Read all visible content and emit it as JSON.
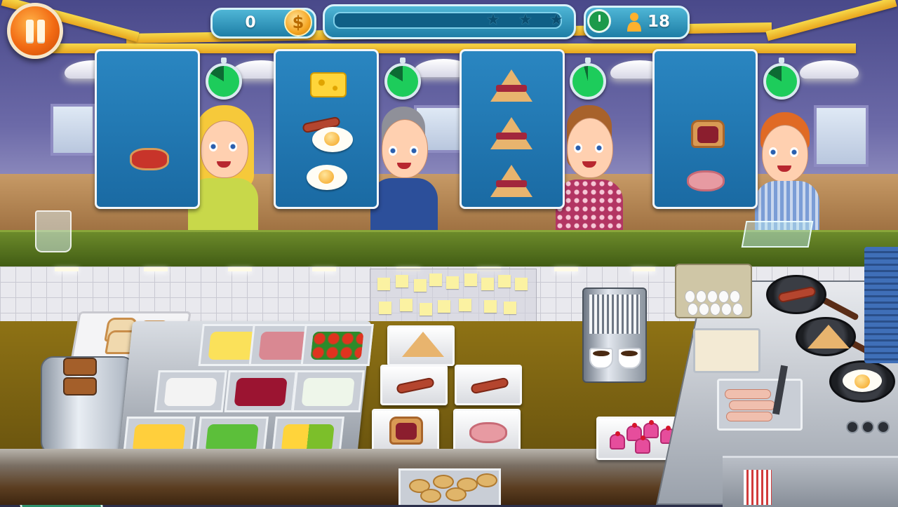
{
  "hud": {
    "score": "0",
    "coin_symbol": "$",
    "progress_fraction": 0,
    "stars": [
      "★",
      "★",
      "★"
    ],
    "customers_left": "18"
  },
  "orders": [
    {
      "items": [
        "tomato-toast"
      ],
      "timer_fraction": 0.85
    },
    {
      "items": [
        "cheese",
        "sausage-and-egg",
        "fried-egg"
      ],
      "timer_fraction": 0.85
    },
    {
      "items": [
        "jam-crepe",
        "jam-crepe",
        "jam-crepe"
      ],
      "timer_fraction": 0.95
    },
    {
      "items": [
        "jam-toast",
        "ham-toast"
      ],
      "timer_fraction": 0.85
    }
  ],
  "icons": {
    "pause": "pause-icon",
    "coin": "coin-icon",
    "timer": "stopwatch-icon",
    "customer": "person-icon",
    "recycle": "recycle-icon"
  },
  "recycle_symbol": "♻",
  "colors": {
    "hud_blue": "#1e7ea6",
    "counter_green": "#3f5a13",
    "timer_green": "#1dcc5b",
    "pause_orange": "#f26a13"
  }
}
